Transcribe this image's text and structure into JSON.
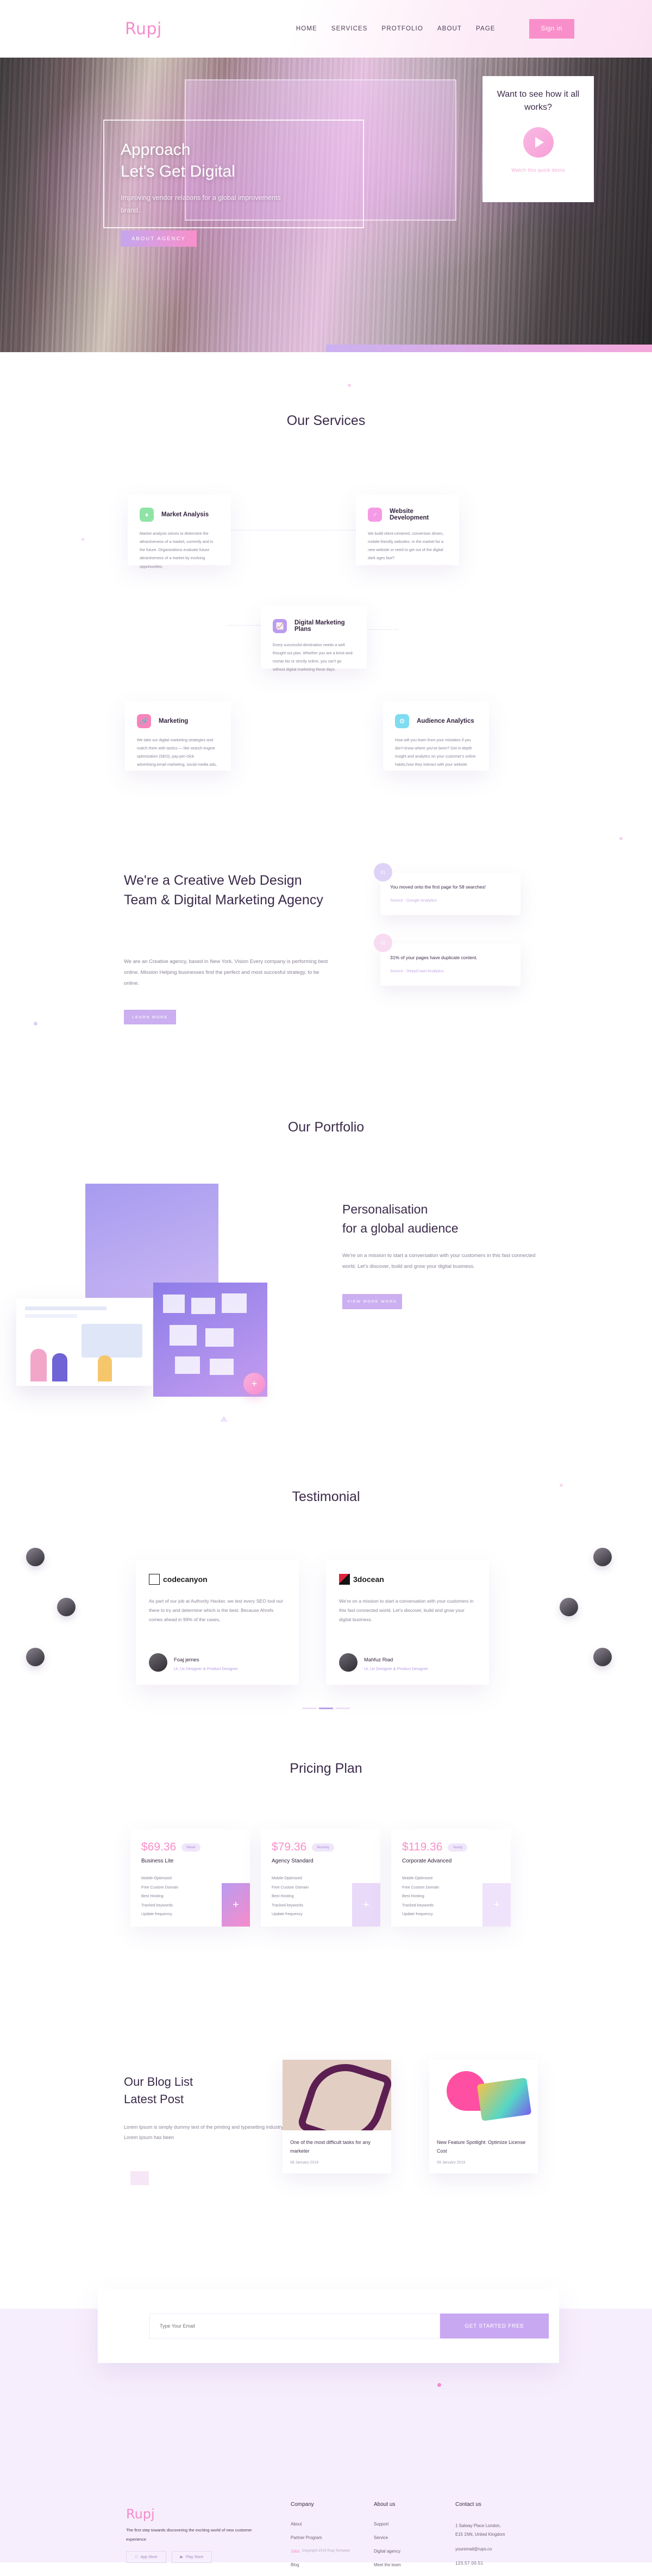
{
  "brand": {
    "name": "Rupj",
    "accent_pink": "#f58ccb",
    "accent_purple": "#cbaff0"
  },
  "header": {
    "logo": "Rupj",
    "nav": [
      {
        "label": "HOME"
      },
      {
        "label": "SERVICES"
      },
      {
        "label": "PROTFOLIO"
      },
      {
        "label": "ABOUT"
      },
      {
        "label": "PAGE"
      }
    ],
    "signin_label": "Sign in"
  },
  "hero": {
    "title_line1": "Approach",
    "title_line2": "Let's Get Digital",
    "subtitle": "Improving vendor relations for a global improvements brand.",
    "cta_label": "ABOUT AGENCY",
    "video_card": {
      "title": "Want to see how it all works?",
      "play_icon": "play-icon",
      "caption": "Watch this quick demo"
    }
  },
  "services": {
    "title": "Our Services",
    "cards": [
      {
        "title": "Market Analysis",
        "icon": "flame-icon",
        "icon_color": "#8fe3a5",
        "text": "Market analysis strives to determine the attractiveness of a market, currently and in the future. Organizations evaluate future attractiveness of a market by evolving opportunities,"
      },
      {
        "title": "Website Development",
        "icon": "mars-icon",
        "icon_color": "#f59ae4",
        "text": "We build client-centered, conversion driven, mobile-friendly websites. In the market for a new website or need to get out of the digital dark ages fast?"
      },
      {
        "title": "Digital Marketing Plans",
        "icon": "chart-icon",
        "icon_color": "#bb9bf0",
        "text": "Every successful destination needs a well thought out plan. Whether you are a brick-and-mortar biz or strictly online, you can't go without digital marketing these days."
      },
      {
        "title": "Marketing",
        "icon": "link-icon",
        "icon_color": "#f884bb",
        "text": "We take our digital marketing strategies and match them with tactics — like search engine optimization (SEO), pay-per-click advertising,email marketing, social media ads,"
      },
      {
        "title": "Audience Analytics",
        "icon": "cogs-icon",
        "icon_color": "#7fdcf0",
        "text": "How will you learn from your mistakes if you don't know where you've been? Get in-depth insight and analytics on your customer's online habits,how they interact with your website"
      }
    ]
  },
  "creative": {
    "heading": "We're a Creative Web Design Team & Digital Marketing Agency",
    "paragraph": "We are an Creative agency, based in New York. Vision Every company is performing best online. Mission Helping businesses find the perfect and most succesful strategy, to be online.",
    "cta_label": "LEARN MORE",
    "stats": [
      {
        "num": "01",
        "text": "You moved onto the first page for 58 searches!",
        "source": "Source : Google Analytics"
      },
      {
        "num": "02",
        "text": "31% of your pages have duplicate content.",
        "source": "Source : DeepCrawl Analytics"
      }
    ]
  },
  "portfolio": {
    "title": "Our Portfolio",
    "heading_line1": "Personalisation",
    "heading_line2": "for a global audience",
    "paragraph": "We're on a mission to start a conversation with your customers in this fast connected world. Let's discover, build and grow your digital business.",
    "cta_label": "VIEW MORE WORK",
    "fab_icon": "plus-icon"
  },
  "testimonial": {
    "title": "Testimonial",
    "cards": [
      {
        "logo": "codecanyon",
        "logo_icon": "codecanyon-logo",
        "text": "As part of our job at Authority Hacker, we test every SEO tool out there to try and determine which is the best. Because Ahrefs comes ahead in 99% of the cases,",
        "author": "Foaj jemes",
        "role": "Ui, Ux Designer & Product Designer"
      },
      {
        "logo": "3docean",
        "logo_icon": "3docean-logo",
        "text": "We're on a mission to start a conversation with your customers in this fast connected world. Let's discover, build and grow your digital business.",
        "author": "Mahfuz Riad",
        "role": "Ui, Ux Designer & Product Designer"
      }
    ]
  },
  "pricing": {
    "title": "Pricing Plan",
    "plans": [
      {
        "price": "$69.36",
        "period": "Week",
        "name": "Business Lite",
        "features": [
          "Mobile-Optimized",
          "Free Custom Domain",
          "Best Hosting",
          "Tracked keywords",
          "Update frequency"
        ],
        "cta_icon": "plus-icon",
        "highlight": true
      },
      {
        "price": "$79.36",
        "period": "Monthly",
        "name": "Agency Standard",
        "features": [
          "Mobile-Optimized",
          "Free Custom Domain",
          "Best Hosting",
          "Tracked keywords",
          "Update frequency"
        ],
        "cta_icon": "plus-icon",
        "highlight": false
      },
      {
        "price": "$119.36",
        "period": "Yearly",
        "name": "Corporate Advanced",
        "features": [
          "Mobile-Optimized",
          "Free Custom Domain",
          "Best Hosting",
          "Tracked keywords",
          "Update frequency"
        ],
        "cta_icon": "plus-icon",
        "highlight": false
      }
    ]
  },
  "blog": {
    "heading_line1": "Our Blog List",
    "heading_line2": "Latest Post",
    "paragraph": "Lorem Ipsum is simply dummy text of the printing and typesetting industry. Lorem Ipsum has been",
    "posts": [
      {
        "title": "One of the most difficult tasks for any marketer",
        "date": "08 January 2019"
      },
      {
        "title": "New Feature Spotlight: Optimize License Cost",
        "date": "09 January 2019"
      }
    ]
  },
  "subscribe": {
    "email_placeholder": "Type Your Email",
    "email_value": "",
    "cta_label": "GET STARTED FREE"
  },
  "footer": {
    "logo": "Rupj",
    "about": "The first step towards discovering the exciting world of new customer experience",
    "stores": [
      {
        "label": "App Store",
        "icon": "apple-icon"
      },
      {
        "label": "Play Store",
        "icon": "play-icon"
      }
    ],
    "columns": [
      {
        "title": "Company",
        "links": [
          {
            "label": "About"
          },
          {
            "label": "Partner Program"
          },
          {
            "label": "Jobs",
            "highlight": true
          },
          {
            "label": "Blog"
          }
        ]
      },
      {
        "title": "About us",
        "links": [
          {
            "label": "Support"
          },
          {
            "label": "Service"
          },
          {
            "label": "Digital agency"
          },
          {
            "label": "Meet the team"
          }
        ]
      }
    ],
    "contact": {
      "title": "Contact us",
      "address_line1": "1 Salway Place London,",
      "address_line2": "E15 1NN, United Kingdom",
      "email": "youremail@rups.co",
      "phone": "123.57.00.51"
    },
    "copyright": "Copyright 2019 Rupj Template"
  }
}
